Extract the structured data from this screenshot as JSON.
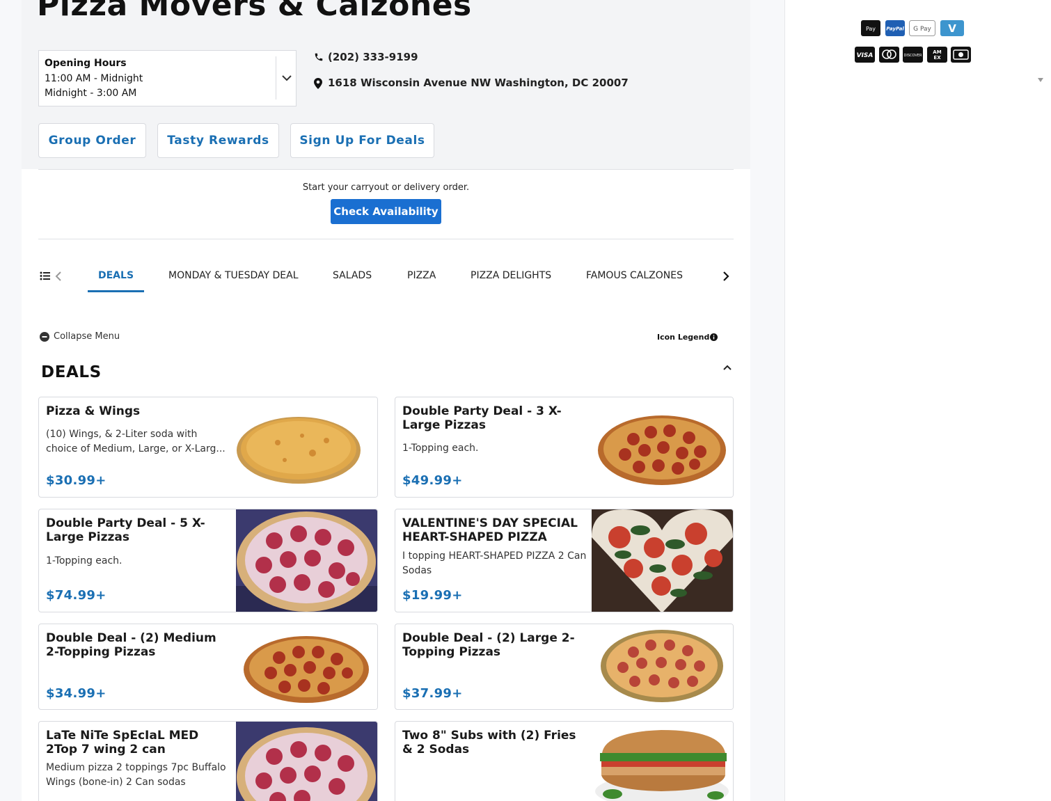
{
  "restaurant": {
    "name": "Pizza Movers & Calzones",
    "phone": "(202) 333-9199",
    "address": "1618 Wisconsin Avenue NW Washington, DC 20007"
  },
  "hours": {
    "title": "Opening Hours",
    "line1": "11:00 AM - Midnight",
    "line2": "Midnight - 3:00 AM"
  },
  "header_buttons": {
    "group_order": "Group Order",
    "rewards": "Tasty Rewards",
    "deals_signup": "Sign Up For Deals"
  },
  "order_prompt": {
    "text": "Start your carryout or delivery order.",
    "button": "Check Availability"
  },
  "categories": [
    {
      "label": "DEALS",
      "active": true
    },
    {
      "label": "MONDAY & TUESDAY DEAL",
      "active": false
    },
    {
      "label": "SALADS",
      "active": false
    },
    {
      "label": "PIZZA",
      "active": false
    },
    {
      "label": "PIZZA DELIGHTS",
      "active": false
    },
    {
      "label": "FAMOUS CALZONES",
      "active": false
    }
  ],
  "menu_controls": {
    "collapse": "Collapse Menu",
    "legend": "Icon Legend"
  },
  "section": {
    "title": "DEALS"
  },
  "items": [
    {
      "name": "Pizza & Wings",
      "desc": "(10) Wings, & 2-Liter soda with choice of Medium, Large, or X-Larg...",
      "price": "$30.99+",
      "image": "cheese-pizza"
    },
    {
      "name": "Double Party Deal - 3 X-Large Pizzas",
      "desc": "1-Topping each.",
      "price": "$49.99+",
      "image": "pepperoni-pizza"
    },
    {
      "name": "Double Party Deal - 5 X-Large Pizzas",
      "desc": "1-Topping each.",
      "price": "$74.99+",
      "image": "pepperoni-pizza-photo"
    },
    {
      "name": "VALENTINE'S DAY SPECIAL HEART-SHAPED PIZZA",
      "desc": "I topping HEART-SHAPED PIZZA 2 Can Sodas",
      "price": "$19.99+",
      "image": "heart-pizza"
    },
    {
      "name": "Double Deal - (2) Medium 2-Topping Pizzas",
      "desc": "",
      "price": "$34.99+",
      "image": "pepperoni-pizza"
    },
    {
      "name": "Double Deal - (2) Large 2-Topping Pizzas",
      "desc": "",
      "price": "$37.99+",
      "image": "salami-pizza"
    },
    {
      "name": "LaTe NiTe SpEcIaL  MED 2Top 7 wing 2 can",
      "desc": "Medium pizza 2 toppings 7pc Buffalo Wings (bone-in) 2 Can sodas",
      "price": "",
      "image": "pepperoni-pizza-photo"
    },
    {
      "name": "Two 8\" Subs with (2) Fries & 2 Sodas",
      "desc": "",
      "price": "",
      "image": "sub-sandwich"
    }
  ],
  "payment_methods": [
    "apple-pay",
    "paypal",
    "google-pay",
    "venmo",
    "visa",
    "mastercard",
    "discover",
    "amex",
    "cash"
  ],
  "colors": {
    "accent": "#1a6fb3",
    "button": "#1a6fd1",
    "header_bg": "#f3f4f6"
  }
}
